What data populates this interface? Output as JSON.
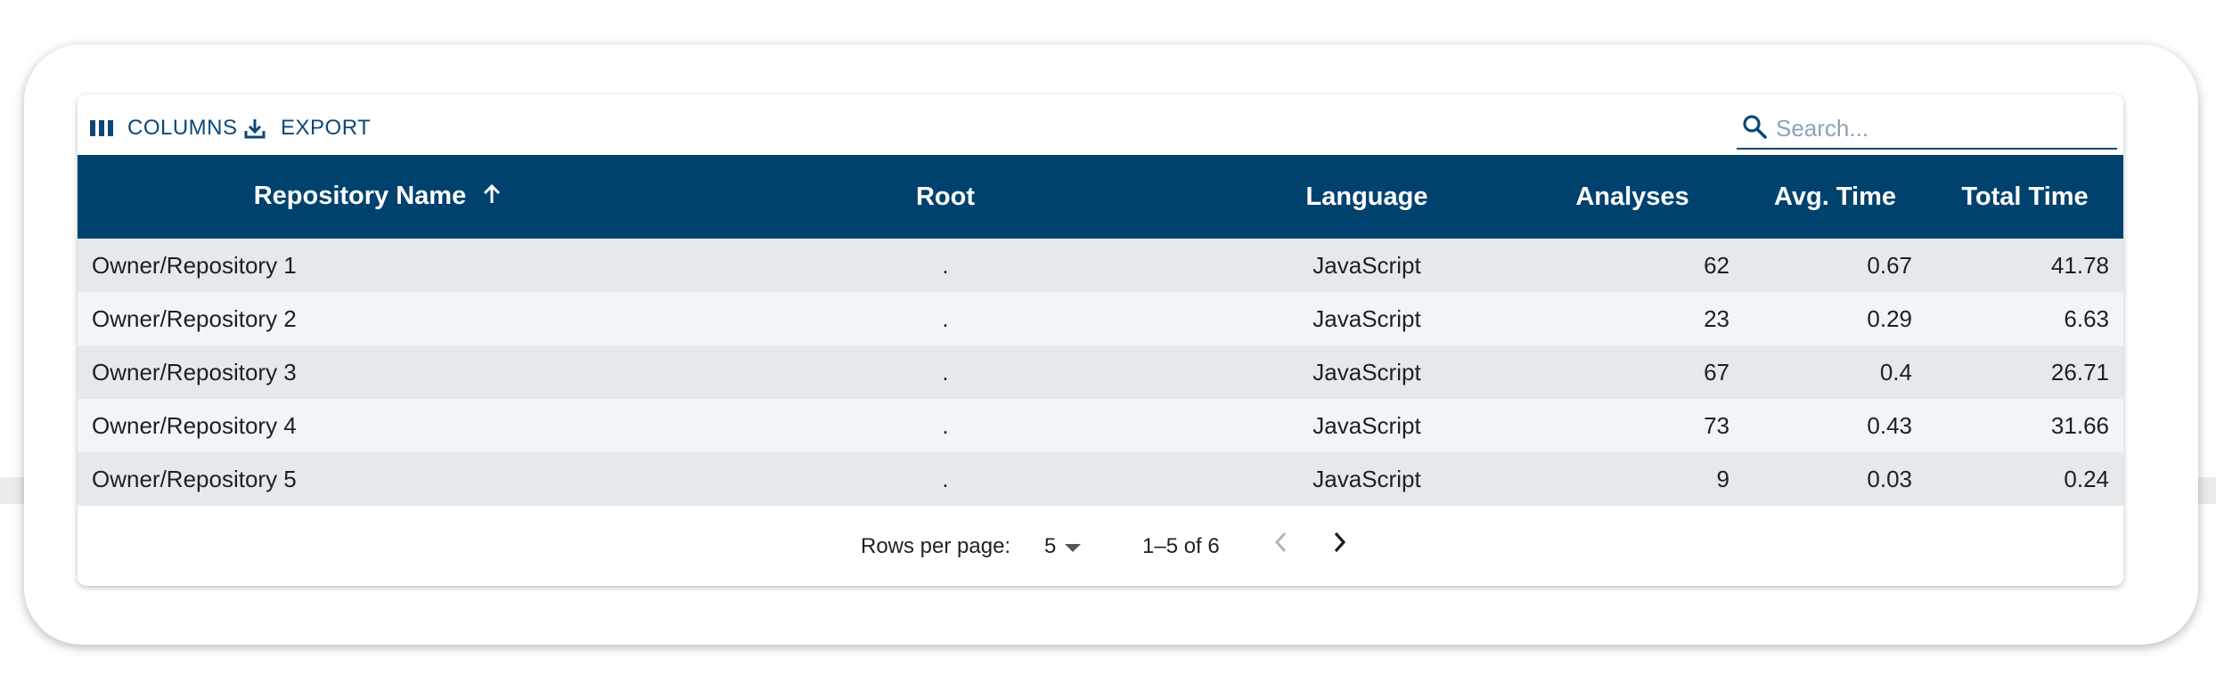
{
  "toolbar": {
    "columns_label": "COLUMNS",
    "export_label": "EXPORT",
    "columns_icon": "view-column-icon",
    "export_icon": "download-icon"
  },
  "search": {
    "placeholder": "Search...",
    "value": "",
    "icon": "search-icon"
  },
  "table": {
    "columns": [
      {
        "label": "Repository Name",
        "sort": "ascending"
      },
      {
        "label": "Root"
      },
      {
        "label": "Language"
      },
      {
        "label": "Analyses"
      },
      {
        "label": "Avg. Time"
      },
      {
        "label": "Total Time"
      }
    ],
    "rows": [
      {
        "name": "Owner/Repository 1",
        "root": ".",
        "language": "JavaScript",
        "analyses": "62",
        "avg_time": "0.67",
        "total_time": "41.78"
      },
      {
        "name": "Owner/Repository 2",
        "root": ".",
        "language": "JavaScript",
        "analyses": "23",
        "avg_time": "0.29",
        "total_time": "6.63"
      },
      {
        "name": "Owner/Repository 3",
        "root": ".",
        "language": "JavaScript",
        "analyses": "67",
        "avg_time": "0.4",
        "total_time": "26.71"
      },
      {
        "name": "Owner/Repository 4",
        "root": ".",
        "language": "JavaScript",
        "analyses": "73",
        "avg_time": "0.43",
        "total_time": "31.66"
      },
      {
        "name": "Owner/Repository 5",
        "root": ".",
        "language": "JavaScript",
        "analyses": "9",
        "avg_time": "0.03",
        "total_time": "0.24"
      }
    ]
  },
  "pagination": {
    "rows_per_page_label": "Rows per page:",
    "rows_per_page_value": "5",
    "range_text": "1–5 of 6",
    "prev_enabled": false,
    "next_enabled": true
  },
  "colors": {
    "header_bg": "#00426e",
    "accent": "#0b4878",
    "row_odd": "#e6e9ec",
    "row_even": "#f2f5f8"
  }
}
